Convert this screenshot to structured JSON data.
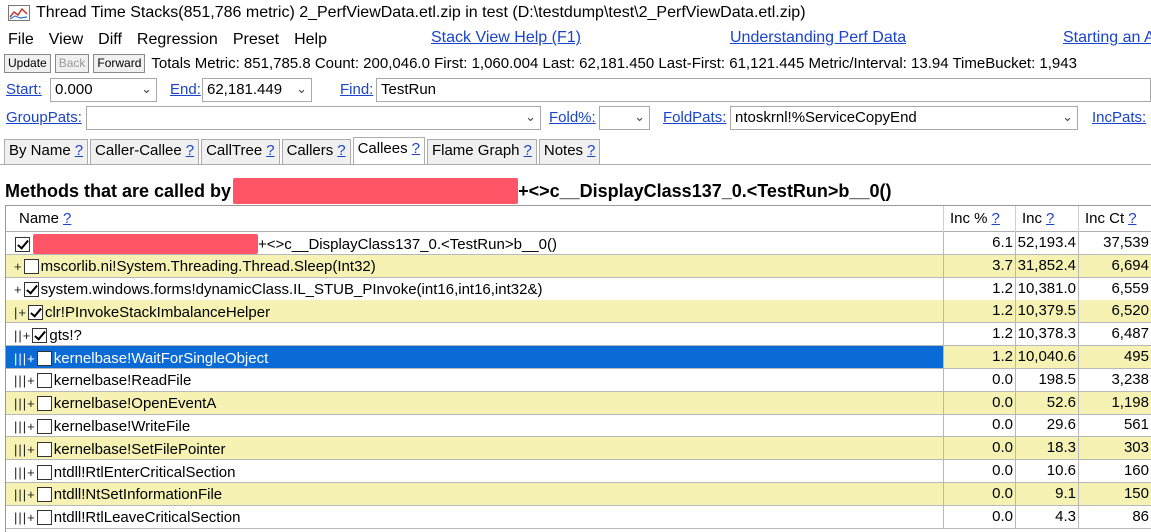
{
  "window": {
    "title": "Thread Time Stacks(851,786 metric) 2_PerfViewData.etl.zip in test (D:\\testdump\\test\\2_PerfViewData.etl.zip)"
  },
  "menu": {
    "items": [
      "File",
      "View",
      "Diff",
      "Regression",
      "Preset",
      "Help"
    ],
    "links": [
      "Stack View Help (F1)",
      "Understanding Perf Data",
      "Starting an A"
    ]
  },
  "toolbar": {
    "update_label": "Update",
    "back_label": "Back",
    "forward_label": "Forward",
    "stats": "Totals Metric: 851,785.8  Count: 200,046.0  First: 1,060.004  Last: 62,181.450  Last-First: 61,121.445  Metric/Interval: 13.94  TimeBucket: 1,943"
  },
  "filters": {
    "start_label": "Start:",
    "start_value": "0.000",
    "end_label": "End:",
    "end_value": "62,181.449",
    "find_label": "Find:",
    "find_value": "TestRun",
    "grouppats_label": "GroupPats:",
    "grouppats_value": "",
    "foldpct_label": "Fold%:",
    "foldpct_value": "",
    "foldpats_label": "FoldPats:",
    "foldpats_value": "ntoskrnl!%ServiceCopyEnd",
    "incpats_label": "IncPats:"
  },
  "tabs": [
    {
      "label": "By Name",
      "help": "?"
    },
    {
      "label": "Caller-Callee",
      "help": "?"
    },
    {
      "label": "CallTree",
      "help": "?"
    },
    {
      "label": "Callers",
      "help": "?"
    },
    {
      "label": "Callees",
      "help": "?"
    },
    {
      "label": "Flame Graph",
      "help": "?"
    },
    {
      "label": "Notes",
      "help": "?"
    }
  ],
  "active_tab": "Callees",
  "heading": {
    "prefix": "Methods that are called by",
    "suffix": "+<>c__DisplayClass137_0.<TestRun>b__0()"
  },
  "grid": {
    "columns": [
      {
        "label": "Name",
        "help": "?"
      },
      {
        "label": "Inc %",
        "help": "?"
      },
      {
        "label": "Inc",
        "help": "?"
      },
      {
        "label": "Inc Ct",
        "help": "?"
      }
    ],
    "rows": [
      {
        "tree": "",
        "checked": true,
        "redacted": true,
        "name": "+<>c__DisplayClass137_0.<TestRun>b__0()",
        "inc_pct": "6.1",
        "inc": "52,193.4",
        "inc_ct": "37,539",
        "highlight": false,
        "selected": false
      },
      {
        "tree": "+",
        "checked": false,
        "redacted": false,
        "name": "mscorlib.ni!System.Threading.Thread.Sleep(Int32)",
        "inc_pct": "3.7",
        "inc": "31,852.4",
        "inc_ct": "6,694",
        "highlight": true,
        "selected": false
      },
      {
        "tree": "+",
        "checked": true,
        "redacted": false,
        "name": "system.windows.forms!dynamicClass.IL_STUB_PInvoke(int16,int16,int32&)",
        "inc_pct": "1.2",
        "inc": "10,381.0",
        "inc_ct": "6,559",
        "highlight": false,
        "selected": false
      },
      {
        "tree": "|+",
        "checked": true,
        "redacted": false,
        "name": "clr!PInvokeStackImbalanceHelper",
        "inc_pct": "1.2",
        "inc": "10,379.5",
        "inc_ct": "6,520",
        "highlight": true,
        "selected": false
      },
      {
        "tree": "||+",
        "checked": true,
        "redacted": false,
        "name": "gts!?",
        "inc_pct": "1.2",
        "inc": "10,378.3",
        "inc_ct": "6,487",
        "highlight": false,
        "selected": false
      },
      {
        "tree": "|||+",
        "checked": false,
        "redacted": false,
        "name": "kernelbase!WaitForSingleObject",
        "inc_pct": "1.2",
        "inc": "10,040.6",
        "inc_ct": "495",
        "highlight": true,
        "selected": true
      },
      {
        "tree": "|||+",
        "checked": false,
        "redacted": false,
        "name": "kernelbase!ReadFile",
        "inc_pct": "0.0",
        "inc": "198.5",
        "inc_ct": "3,238",
        "highlight": false,
        "selected": false
      },
      {
        "tree": "|||+",
        "checked": false,
        "redacted": false,
        "name": "kernelbase!OpenEventA",
        "inc_pct": "0.0",
        "inc": "52.6",
        "inc_ct": "1,198",
        "highlight": true,
        "selected": false
      },
      {
        "tree": "|||+",
        "checked": false,
        "redacted": false,
        "name": "kernelbase!WriteFile",
        "inc_pct": "0.0",
        "inc": "29.6",
        "inc_ct": "561",
        "highlight": false,
        "selected": false
      },
      {
        "tree": "|||+",
        "checked": false,
        "redacted": false,
        "name": "kernelbase!SetFilePointer",
        "inc_pct": "0.0",
        "inc": "18.3",
        "inc_ct": "303",
        "highlight": true,
        "selected": false
      },
      {
        "tree": "|||+",
        "checked": false,
        "redacted": false,
        "name": "ntdll!RtlEnterCriticalSection",
        "inc_pct": "0.0",
        "inc": "10.6",
        "inc_ct": "160",
        "highlight": false,
        "selected": false
      },
      {
        "tree": "|||+",
        "checked": false,
        "redacted": false,
        "name": "ntdll!NtSetInformationFile",
        "inc_pct": "0.0",
        "inc": "9.1",
        "inc_ct": "150",
        "highlight": true,
        "selected": false
      },
      {
        "tree": "|||+",
        "checked": false,
        "redacted": false,
        "name": "ntdll!RtlLeaveCriticalSection",
        "inc_pct": "0.0",
        "inc": "4.3",
        "inc_ct": "86",
        "highlight": false,
        "selected": false
      }
    ]
  },
  "colors": {
    "highlight_row": "#f5f2b4",
    "selected_row": "#0a6ad6",
    "link": "#1a44c9",
    "redaction": "#ff5566"
  }
}
